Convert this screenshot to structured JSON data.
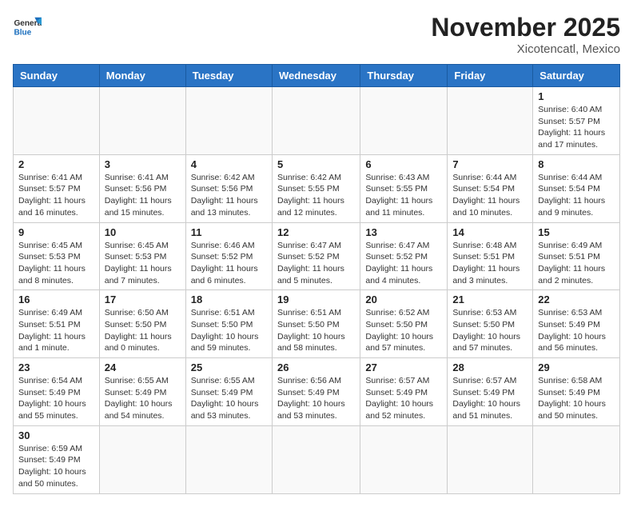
{
  "header": {
    "logo_general": "General",
    "logo_blue": "Blue",
    "month_title": "November 2025",
    "location": "Xicotencatl, Mexico"
  },
  "days_of_week": [
    "Sunday",
    "Monday",
    "Tuesday",
    "Wednesday",
    "Thursday",
    "Friday",
    "Saturday"
  ],
  "weeks": [
    [
      {
        "day": "",
        "info": ""
      },
      {
        "day": "",
        "info": ""
      },
      {
        "day": "",
        "info": ""
      },
      {
        "day": "",
        "info": ""
      },
      {
        "day": "",
        "info": ""
      },
      {
        "day": "",
        "info": ""
      },
      {
        "day": "1",
        "info": "Sunrise: 6:40 AM\nSunset: 5:57 PM\nDaylight: 11 hours and 17 minutes."
      }
    ],
    [
      {
        "day": "2",
        "info": "Sunrise: 6:41 AM\nSunset: 5:57 PM\nDaylight: 11 hours and 16 minutes."
      },
      {
        "day": "3",
        "info": "Sunrise: 6:41 AM\nSunset: 5:56 PM\nDaylight: 11 hours and 15 minutes."
      },
      {
        "day": "4",
        "info": "Sunrise: 6:42 AM\nSunset: 5:56 PM\nDaylight: 11 hours and 13 minutes."
      },
      {
        "day": "5",
        "info": "Sunrise: 6:42 AM\nSunset: 5:55 PM\nDaylight: 11 hours and 12 minutes."
      },
      {
        "day": "6",
        "info": "Sunrise: 6:43 AM\nSunset: 5:55 PM\nDaylight: 11 hours and 11 minutes."
      },
      {
        "day": "7",
        "info": "Sunrise: 6:44 AM\nSunset: 5:54 PM\nDaylight: 11 hours and 10 minutes."
      },
      {
        "day": "8",
        "info": "Sunrise: 6:44 AM\nSunset: 5:54 PM\nDaylight: 11 hours and 9 minutes."
      }
    ],
    [
      {
        "day": "9",
        "info": "Sunrise: 6:45 AM\nSunset: 5:53 PM\nDaylight: 11 hours and 8 minutes."
      },
      {
        "day": "10",
        "info": "Sunrise: 6:45 AM\nSunset: 5:53 PM\nDaylight: 11 hours and 7 minutes."
      },
      {
        "day": "11",
        "info": "Sunrise: 6:46 AM\nSunset: 5:52 PM\nDaylight: 11 hours and 6 minutes."
      },
      {
        "day": "12",
        "info": "Sunrise: 6:47 AM\nSunset: 5:52 PM\nDaylight: 11 hours and 5 minutes."
      },
      {
        "day": "13",
        "info": "Sunrise: 6:47 AM\nSunset: 5:52 PM\nDaylight: 11 hours and 4 minutes."
      },
      {
        "day": "14",
        "info": "Sunrise: 6:48 AM\nSunset: 5:51 PM\nDaylight: 11 hours and 3 minutes."
      },
      {
        "day": "15",
        "info": "Sunrise: 6:49 AM\nSunset: 5:51 PM\nDaylight: 11 hours and 2 minutes."
      }
    ],
    [
      {
        "day": "16",
        "info": "Sunrise: 6:49 AM\nSunset: 5:51 PM\nDaylight: 11 hours and 1 minute."
      },
      {
        "day": "17",
        "info": "Sunrise: 6:50 AM\nSunset: 5:50 PM\nDaylight: 11 hours and 0 minutes."
      },
      {
        "day": "18",
        "info": "Sunrise: 6:51 AM\nSunset: 5:50 PM\nDaylight: 10 hours and 59 minutes."
      },
      {
        "day": "19",
        "info": "Sunrise: 6:51 AM\nSunset: 5:50 PM\nDaylight: 10 hours and 58 minutes."
      },
      {
        "day": "20",
        "info": "Sunrise: 6:52 AM\nSunset: 5:50 PM\nDaylight: 10 hours and 57 minutes."
      },
      {
        "day": "21",
        "info": "Sunrise: 6:53 AM\nSunset: 5:50 PM\nDaylight: 10 hours and 57 minutes."
      },
      {
        "day": "22",
        "info": "Sunrise: 6:53 AM\nSunset: 5:49 PM\nDaylight: 10 hours and 56 minutes."
      }
    ],
    [
      {
        "day": "23",
        "info": "Sunrise: 6:54 AM\nSunset: 5:49 PM\nDaylight: 10 hours and 55 minutes."
      },
      {
        "day": "24",
        "info": "Sunrise: 6:55 AM\nSunset: 5:49 PM\nDaylight: 10 hours and 54 minutes."
      },
      {
        "day": "25",
        "info": "Sunrise: 6:55 AM\nSunset: 5:49 PM\nDaylight: 10 hours and 53 minutes."
      },
      {
        "day": "26",
        "info": "Sunrise: 6:56 AM\nSunset: 5:49 PM\nDaylight: 10 hours and 53 minutes."
      },
      {
        "day": "27",
        "info": "Sunrise: 6:57 AM\nSunset: 5:49 PM\nDaylight: 10 hours and 52 minutes."
      },
      {
        "day": "28",
        "info": "Sunrise: 6:57 AM\nSunset: 5:49 PM\nDaylight: 10 hours and 51 minutes."
      },
      {
        "day": "29",
        "info": "Sunrise: 6:58 AM\nSunset: 5:49 PM\nDaylight: 10 hours and 50 minutes."
      }
    ],
    [
      {
        "day": "30",
        "info": "Sunrise: 6:59 AM\nSunset: 5:49 PM\nDaylight: 10 hours and 50 minutes."
      },
      {
        "day": "",
        "info": ""
      },
      {
        "day": "",
        "info": ""
      },
      {
        "day": "",
        "info": ""
      },
      {
        "day": "",
        "info": ""
      },
      {
        "day": "",
        "info": ""
      },
      {
        "day": "",
        "info": ""
      }
    ]
  ]
}
